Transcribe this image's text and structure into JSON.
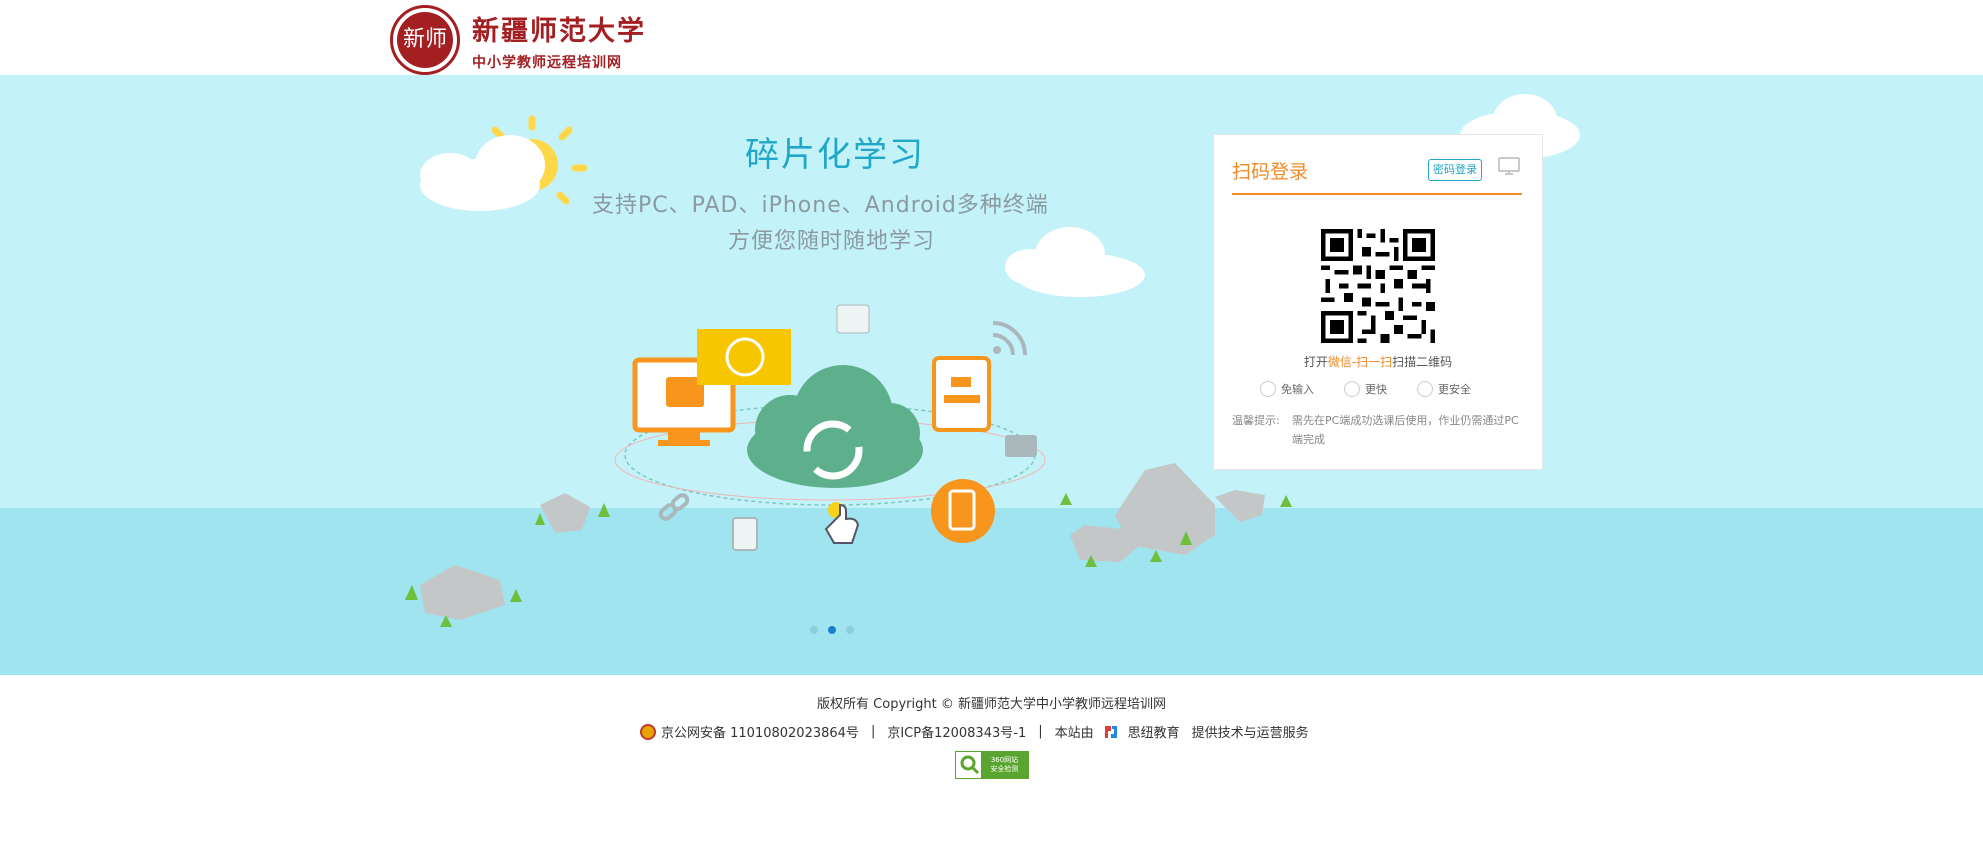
{
  "header": {
    "logo_seal_text": "新师",
    "logo_title": "新疆师范大学",
    "logo_subtitle": "中小学教师远程培训网"
  },
  "banner": {
    "slide_title": "碎片化学习",
    "slide_line1": "支持PC、PAD、iPhone、Android多种终端",
    "slide_line2": "方便您随时随地学习",
    "carousel_count": 3,
    "carousel_active_index": 1
  },
  "login": {
    "title": "扫码登录",
    "password_login_label": "密码登录",
    "scan_prefix": "打开",
    "scan_highlight": "微信-扫一扫",
    "scan_suffix": "扫描二维码",
    "features": [
      "免输入",
      "更快",
      "更安全"
    ],
    "tip_label": "温馨提示:",
    "tip_text": "需先在PC端成功选课后使用，作业仍需通过PC端完成"
  },
  "footer": {
    "copyright": "版权所有 Copyright © 新疆师范大学中小学教师远程培训网",
    "police_record": "京公网安备 11010802023864号",
    "icp_record": "京ICP备12008343号-1",
    "site_by": "本站由",
    "provider_name": "思纽教育",
    "provider_service": "提供技术与运营服务",
    "badge_line1": "360网站",
    "badge_line2": "安全检测"
  },
  "colors": {
    "brand_red": "#a31f22",
    "accent_orange": "#f28a28",
    "accent_cyan": "#1fa6c8",
    "banner_sky": "#c3f3f9",
    "banner_water": "#9fe4ee"
  }
}
